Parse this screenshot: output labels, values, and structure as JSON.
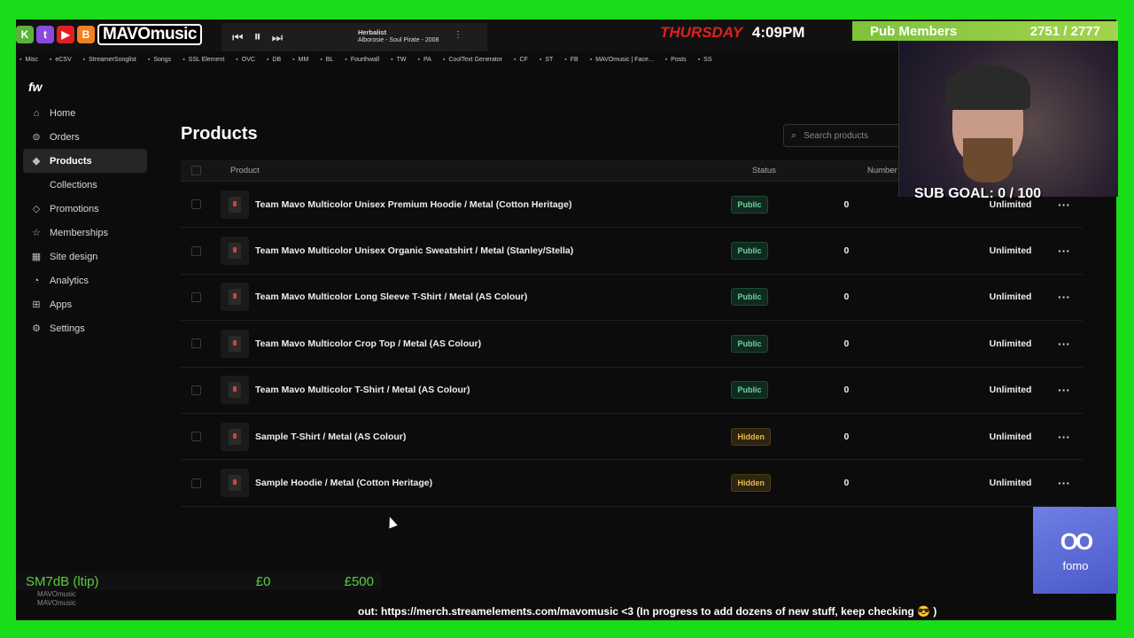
{
  "overlay": {
    "brand": "MAVOmusic",
    "player": {
      "title": "Herbalist",
      "artist": "Alborosie - Soul Pirate - 2008"
    },
    "clock": {
      "day": "THURSDAY",
      "time": "4:09PM"
    },
    "members": {
      "label": "Pub Members",
      "count": "2751 / 2777"
    },
    "sub_goal": "SUB GOAL: 0 / 100",
    "tip": {
      "label": "SM7dB (ltip)",
      "current": "£0",
      "goal": "£500"
    },
    "ticker": "out: https://merch.streamelements.com/mavomusic <3 (In progress to add dozens of new stuff, keep checking 😎 )",
    "fomo": {
      "word": "fomo"
    },
    "account": {
      "name": "MAVOmusic",
      "sub": "MAVOmusic"
    }
  },
  "bookmarks": [
    "Misc",
    "eCSV",
    "StreamerSonglist",
    "Songs",
    "SSL Element",
    "OVC",
    "DB",
    "MM",
    "BL",
    "Fourthwall",
    "TW",
    "PA",
    "CoolText Generator",
    "CF",
    "ST",
    "FB",
    "MAVOmusic | Face...",
    "Posts",
    "SS"
  ],
  "app": {
    "logo": "fw"
  },
  "sidebar": {
    "items": [
      {
        "label": "Home",
        "icon": "home-icon"
      },
      {
        "label": "Orders",
        "icon": "orders-icon"
      },
      {
        "label": "Products",
        "icon": "products-icon"
      },
      {
        "label": "Collections",
        "icon": ""
      },
      {
        "label": "Promotions",
        "icon": "tag-icon"
      },
      {
        "label": "Memberships",
        "icon": "star-icon"
      },
      {
        "label": "Site design",
        "icon": "layout-icon"
      },
      {
        "label": "Analytics",
        "icon": "chart-icon"
      },
      {
        "label": "Apps",
        "icon": "apps-icon"
      },
      {
        "label": "Settings",
        "icon": "gear-icon"
      }
    ]
  },
  "main": {
    "title": "Products",
    "search_placeholder": "Search products",
    "columns": {
      "product": "Product",
      "status": "Status",
      "sold": "Number sold"
    },
    "rows": [
      {
        "name": "Team Mavo Multicolor Unisex Premium Hoodie / Metal (Cotton Heritage)",
        "status": "Public",
        "sold": "0",
        "inventory": "Unlimited"
      },
      {
        "name": "Team Mavo Multicolor Unisex Organic Sweatshirt / Metal (Stanley/Stella)",
        "status": "Public",
        "sold": "0",
        "inventory": "Unlimited"
      },
      {
        "name": "Team Mavo Multicolor Long Sleeve T-Shirt / Metal (AS Colour)",
        "status": "Public",
        "sold": "0",
        "inventory": "Unlimited"
      },
      {
        "name": "Team Mavo Multicolor Crop Top / Metal (AS Colour)",
        "status": "Public",
        "sold": "0",
        "inventory": "Unlimited"
      },
      {
        "name": "Team Mavo Multicolor T-Shirt / Metal (AS Colour)",
        "status": "Public",
        "sold": "0",
        "inventory": "Unlimited"
      },
      {
        "name": "Sample T-Shirt / Metal (AS Colour)",
        "status": "Hidden",
        "sold": "0",
        "inventory": "Unlimited"
      },
      {
        "name": "Sample Hoodie / Metal (Cotton Heritage)",
        "status": "Hidden",
        "sold": "0",
        "inventory": "Unlimited"
      }
    ]
  },
  "colors": {
    "chroma_green": "#1bdc1b",
    "public_badge": "#6fd0a4",
    "hidden_badge": "#e8b84a",
    "background": "#0c0c0c"
  }
}
